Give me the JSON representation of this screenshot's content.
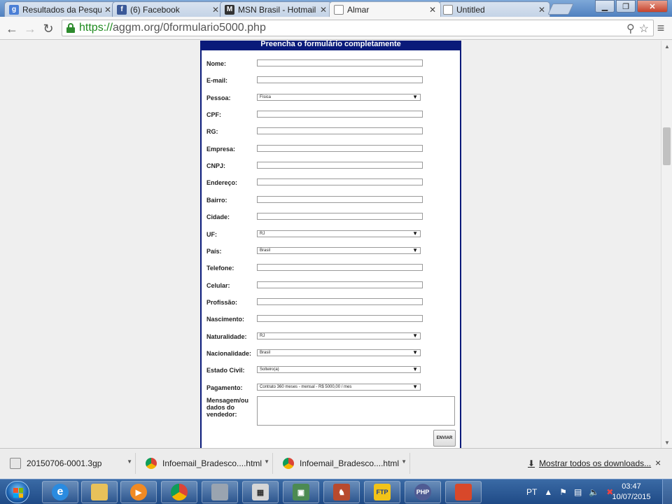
{
  "browser": {
    "tabs": [
      {
        "title": "Resultados da Pesqu",
        "favicon": "google-g-icon",
        "color": "#4a7fd6"
      },
      {
        "title": "(6) Facebook",
        "favicon": "facebook-icon",
        "color": "#3b5998"
      },
      {
        "title": "MSN Brasil - Hotmail",
        "favicon": "msn-icon",
        "color": "#333333"
      },
      {
        "title": "Almar",
        "favicon": "page-icon",
        "color": "#ffffff",
        "active": true
      },
      {
        "title": "Untitled",
        "favicon": "page-icon",
        "color": "#ffffff"
      }
    ],
    "url_scheme": "https://",
    "url_rest": "aggm.org/0formulario5000.php"
  },
  "form": {
    "header": "Preencha o formulário completamente",
    "rows": [
      {
        "label": "Nome:",
        "type": "text"
      },
      {
        "label": "E-mail:",
        "type": "text"
      },
      {
        "label": "Pessoa:",
        "type": "select",
        "value": "Física"
      },
      {
        "label": "CPF:",
        "type": "text"
      },
      {
        "label": "RG:",
        "type": "text"
      },
      {
        "label": "Empresa:",
        "type": "text"
      },
      {
        "label": "CNPJ:",
        "type": "text"
      },
      {
        "label": "Endereço:",
        "type": "text"
      },
      {
        "label": "Bairro:",
        "type": "text"
      },
      {
        "label": "Cidade:",
        "type": "text"
      },
      {
        "label": "UF:",
        "type": "select",
        "value": "RJ"
      },
      {
        "label": "País:",
        "type": "select",
        "value": "Brasil"
      },
      {
        "label": "Telefone:",
        "type": "text"
      },
      {
        "label": "Celular:",
        "type": "text"
      },
      {
        "label": "Profissão:",
        "type": "text"
      },
      {
        "label": "Nascimento:",
        "type": "text"
      },
      {
        "label": "Naturalidade:",
        "type": "select",
        "value": "RJ"
      },
      {
        "label": "Nacionalidade:",
        "type": "select",
        "value": "Brasil"
      },
      {
        "label": "Estado Civil:",
        "type": "select",
        "value": "Solteiro(a)"
      },
      {
        "label": "Pagamento:",
        "type": "select",
        "value": "Contrato 360 meses - mensal - R$ 5000,00 / mes"
      }
    ],
    "message_label_lines": [
      "Mensagem/ou",
      "dados do",
      "vendedor:"
    ],
    "submit_label": "ENVIAR"
  },
  "downloads": {
    "items": [
      {
        "name": "20150706-0001.3gp",
        "icon": "document-icon"
      },
      {
        "name": "Infoemail_Bradesco....html",
        "icon": "chrome-icon"
      },
      {
        "name": "Infoemail_Bradesco....html",
        "icon": "chrome-icon"
      }
    ],
    "show_all": "Mostrar todos os downloads...",
    "close": "×"
  },
  "taskbar": {
    "apps": [
      "ie-icon",
      "folder-icon",
      "media-player-icon",
      "chrome-icon",
      "calculator-icon",
      "network-icon",
      "games-icon",
      "ftp-icon",
      "php-icon",
      "app-icon"
    ],
    "language": "PT",
    "time": "03:47",
    "date": "10/07/2015"
  }
}
